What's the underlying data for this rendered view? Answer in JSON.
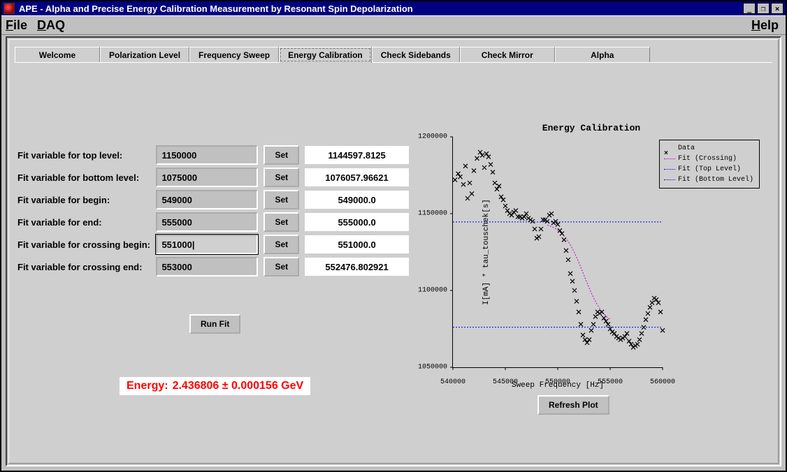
{
  "window": {
    "title": "APE - Alpha and Precise Energy Calibration Measurement by Resonant Spin Depolarization"
  },
  "menu": {
    "file": "File",
    "daq": "DAQ",
    "help": "Help"
  },
  "winbuttons": {
    "min": "_",
    "max": "❐",
    "close": "×"
  },
  "tabs": [
    {
      "id": "welcome",
      "label": "Welcome"
    },
    {
      "id": "polarization",
      "label": "Polarization Level"
    },
    {
      "id": "freqsweep",
      "label": "Frequency Sweep"
    },
    {
      "id": "energycal",
      "label": "Energy Calibration"
    },
    {
      "id": "sidebands",
      "label": "Check Sidebands"
    },
    {
      "id": "mirror",
      "label": "Check Mirror"
    },
    {
      "id": "alpha",
      "label": "Alpha"
    }
  ],
  "active_tab": "energycal",
  "form": {
    "rows": [
      {
        "label": "Fit variable for top level:",
        "value": "1150000",
        "result": "1144597.8125"
      },
      {
        "label": "Fit variable for bottom level:",
        "value": "1075000",
        "result": "1076057.96621"
      },
      {
        "label": "Fit variable for begin:",
        "value": "549000",
        "result": "549000.0"
      },
      {
        "label": "Fit variable for end:",
        "value": "555000",
        "result": "555000.0"
      },
      {
        "label": "Fit variable for crossing begin:",
        "value": "551000",
        "result": "551000.0"
      },
      {
        "label": "Fit variable for crossing end:",
        "value": "553000",
        "result": "552476.802921"
      }
    ],
    "set_label": "Set",
    "run_fit_label": "Run Fit"
  },
  "energy": {
    "label": "Energy:",
    "value": "2.436806 ± 0.000156  GeV"
  },
  "plot": {
    "refresh_label": "Refresh Plot"
  },
  "chart_data": {
    "type": "scatter",
    "title": "Energy Calibration",
    "xlabel": "Sweep Frequency [Hz]",
    "ylabel": "I[mA] * tau_touschek[s]",
    "xlim": [
      540000,
      560000
    ],
    "ylim": [
      1050000,
      1200000
    ],
    "xticks": [
      540000,
      545000,
      550000,
      555000,
      560000
    ],
    "yticks": [
      1050000,
      1100000,
      1150000,
      1200000
    ],
    "legend": [
      "Data",
      "Fit (Crossing)",
      "Fit (Top Level)",
      "Fit (Bottom Level)"
    ],
    "fit_top_level": 1144598,
    "fit_bottom_level": 1076058,
    "fit_crossing": {
      "x_start": 549000,
      "x_mid": 552477,
      "x_end": 555000,
      "y_top": 1144598,
      "y_bottom": 1076058
    },
    "series": [
      {
        "name": "Data",
        "marker": "x",
        "points": [
          [
            540200,
            1172000
          ],
          [
            540500,
            1176000
          ],
          [
            540700,
            1174000
          ],
          [
            541000,
            1169000
          ],
          [
            541200,
            1181000
          ],
          [
            541400,
            1160000
          ],
          [
            541600,
            1170000
          ],
          [
            541800,
            1163000
          ],
          [
            542000,
            1178000
          ],
          [
            542300,
            1186000
          ],
          [
            542600,
            1190000
          ],
          [
            542800,
            1188000
          ],
          [
            543000,
            1180000
          ],
          [
            543200,
            1189000
          ],
          [
            543400,
            1187000
          ],
          [
            543600,
            1182000
          ],
          [
            543800,
            1177000
          ],
          [
            544000,
            1170000
          ],
          [
            544200,
            1166000
          ],
          [
            544400,
            1168000
          ],
          [
            544600,
            1161000
          ],
          [
            544800,
            1159000
          ],
          [
            545000,
            1155000
          ],
          [
            545200,
            1152000
          ],
          [
            545400,
            1150000
          ],
          [
            545600,
            1149000
          ],
          [
            545800,
            1151000
          ],
          [
            546000,
            1152000
          ],
          [
            546200,
            1148000
          ],
          [
            546400,
            1148000
          ],
          [
            546600,
            1147000
          ],
          [
            546800,
            1148000
          ],
          [
            547000,
            1150000
          ],
          [
            547200,
            1147000
          ],
          [
            547400,
            1146000
          ],
          [
            547600,
            1145000
          ],
          [
            547800,
            1140000
          ],
          [
            548000,
            1134000
          ],
          [
            548200,
            1135000
          ],
          [
            548400,
            1140000
          ],
          [
            548600,
            1146000
          ],
          [
            548800,
            1146000
          ],
          [
            549000,
            1145000
          ],
          [
            549200,
            1149000
          ],
          [
            549400,
            1150000
          ],
          [
            549600,
            1144000
          ],
          [
            549800,
            1145000
          ],
          [
            550000,
            1143000
          ],
          [
            550200,
            1139000
          ],
          [
            550400,
            1137000
          ],
          [
            550600,
            1133000
          ],
          [
            550800,
            1126000
          ],
          [
            551000,
            1120000
          ],
          [
            551200,
            1111000
          ],
          [
            551400,
            1106000
          ],
          [
            551600,
            1100000
          ],
          [
            551800,
            1093000
          ],
          [
            552000,
            1086000
          ],
          [
            552200,
            1078000
          ],
          [
            552400,
            1071000
          ],
          [
            552600,
            1068000
          ],
          [
            552800,
            1066000
          ],
          [
            553000,
            1068000
          ],
          [
            553200,
            1074000
          ],
          [
            553400,
            1078000
          ],
          [
            553600,
            1083000
          ],
          [
            553800,
            1086000
          ],
          [
            554000,
            1085000
          ],
          [
            554200,
            1086000
          ],
          [
            554400,
            1082000
          ],
          [
            554600,
            1080000
          ],
          [
            554800,
            1078000
          ],
          [
            555000,
            1075000
          ],
          [
            555200,
            1073000
          ],
          [
            555400,
            1072000
          ],
          [
            555600,
            1070000
          ],
          [
            555800,
            1069000
          ],
          [
            556000,
            1068000
          ],
          [
            556200,
            1069000
          ],
          [
            556400,
            1070000
          ],
          [
            556600,
            1072000
          ],
          [
            556800,
            1067000
          ],
          [
            557000,
            1065000
          ],
          [
            557200,
            1063000
          ],
          [
            557400,
            1064000
          ],
          [
            557600,
            1065000
          ],
          [
            557800,
            1068000
          ],
          [
            558000,
            1072000
          ],
          [
            558200,
            1076000
          ],
          [
            558400,
            1081000
          ],
          [
            558600,
            1085000
          ],
          [
            558800,
            1089000
          ],
          [
            559000,
            1092000
          ],
          [
            559200,
            1095000
          ],
          [
            559400,
            1094000
          ],
          [
            559600,
            1092000
          ],
          [
            559800,
            1086000
          ],
          [
            560000,
            1074000
          ]
        ]
      }
    ]
  }
}
